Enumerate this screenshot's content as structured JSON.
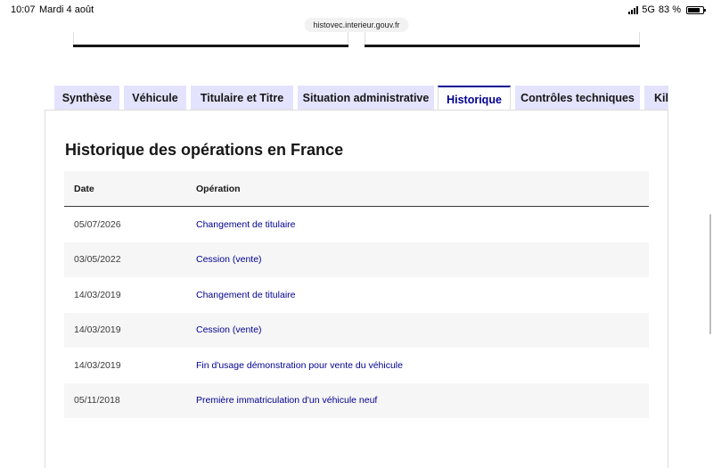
{
  "status_bar": {
    "time": "10:07",
    "date": "Mardi 4 août",
    "network": "5G",
    "battery": "83 %",
    "battery_level": 0.83,
    "url": "histovec.interieur.gouv.fr"
  },
  "tabs": [
    {
      "label": "Synthèse",
      "active": false
    },
    {
      "label": "Véhicule",
      "active": false
    },
    {
      "label": "Titulaire et Titre",
      "active": false
    },
    {
      "label": "Situation administrative",
      "active": false
    },
    {
      "label": "Historique",
      "active": true
    },
    {
      "label": "Contrôles techniques",
      "active": false
    },
    {
      "label": "Kilométrage",
      "active": false
    }
  ],
  "panel": {
    "title": "Historique des opérations en France",
    "columns": [
      "Date",
      "Opération"
    ],
    "rows": [
      {
        "date": "05/07/2026",
        "operation": "Changement de titulaire"
      },
      {
        "date": "03/05/2022",
        "operation": "Cession (vente)"
      },
      {
        "date": "14/03/2019",
        "operation": "Changement de titulaire"
      },
      {
        "date": "14/03/2019",
        "operation": "Cession (vente)"
      },
      {
        "date": "14/03/2019",
        "operation": "Fin d'usage démonstration pour vente du véhicule"
      },
      {
        "date": "05/11/2018",
        "operation": "Première immatriculation d'un véhicule neuf"
      }
    ]
  },
  "colors": {
    "accent": "#000091",
    "tab_background": "#e3e3fd",
    "row_alt": "#f6f6f6"
  }
}
